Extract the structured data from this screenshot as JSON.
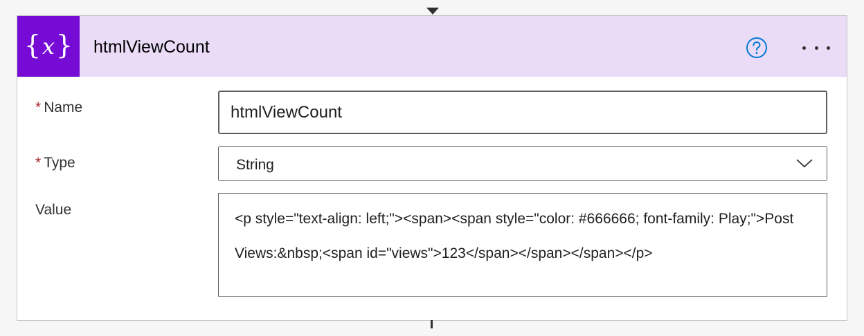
{
  "action": {
    "title": "htmlViewCount",
    "icon": "variable-icon",
    "accent_color": "#770bd6",
    "header_color": "#eadbf7"
  },
  "header_buttons": {
    "help_icon": "help-circle-icon",
    "more_icon": "more-ellipsis-icon"
  },
  "fields": {
    "name": {
      "label": "Name",
      "required_mark": "*",
      "value": "htmlViewCount"
    },
    "type": {
      "label": "Type",
      "required_mark": "*",
      "value": "String",
      "icon": "chevron-down-icon"
    },
    "value": {
      "label": "Value",
      "value": "<p style=\"text-align: left;\"><span><span style=\"color: #666666; font-family: Play;\">Post Views:&nbsp;<span id=\"views\">123</span></span></span></p>"
    }
  }
}
